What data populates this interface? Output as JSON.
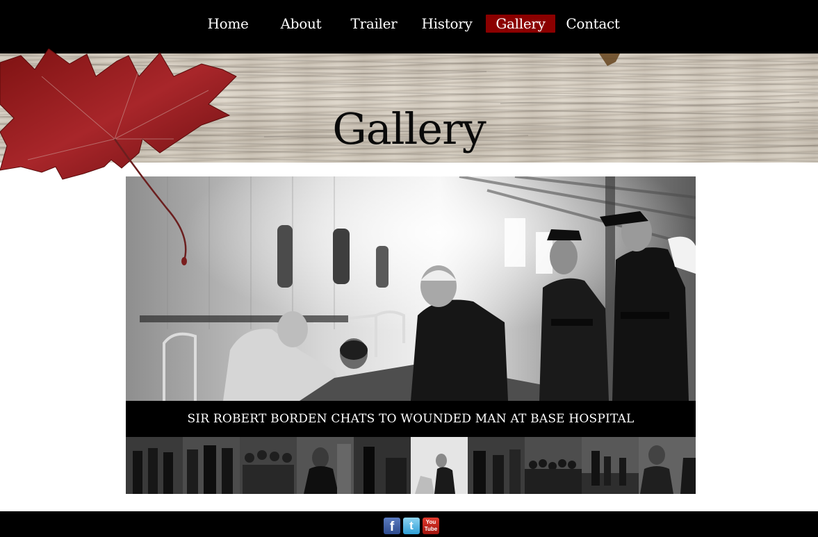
{
  "nav": {
    "items": [
      {
        "label": "Home"
      },
      {
        "label": "About"
      },
      {
        "label": "Trailer"
      },
      {
        "label": "History"
      },
      {
        "label": "Gallery",
        "active": true
      },
      {
        "label": "Contact"
      }
    ]
  },
  "header": {
    "title": "Gallery"
  },
  "slide": {
    "caption": "SIR ROBERT BORDEN CHATS TO WOUNDED MAN AT BASE HOSPITAL",
    "active_thumbnail": 6,
    "thumbnail_count": 10
  },
  "footer": {
    "social": [
      {
        "icon": "facebook-icon",
        "glyph": "f"
      },
      {
        "icon": "twitter-icon",
        "glyph": "t"
      },
      {
        "icon": "youtube-icon",
        "glyph": "You Tube"
      }
    ]
  },
  "colors": {
    "nav_bg": "#000000",
    "active_tab": "#8b0000",
    "footer_bg": "#000000",
    "leaf": "#9b1c1c"
  }
}
